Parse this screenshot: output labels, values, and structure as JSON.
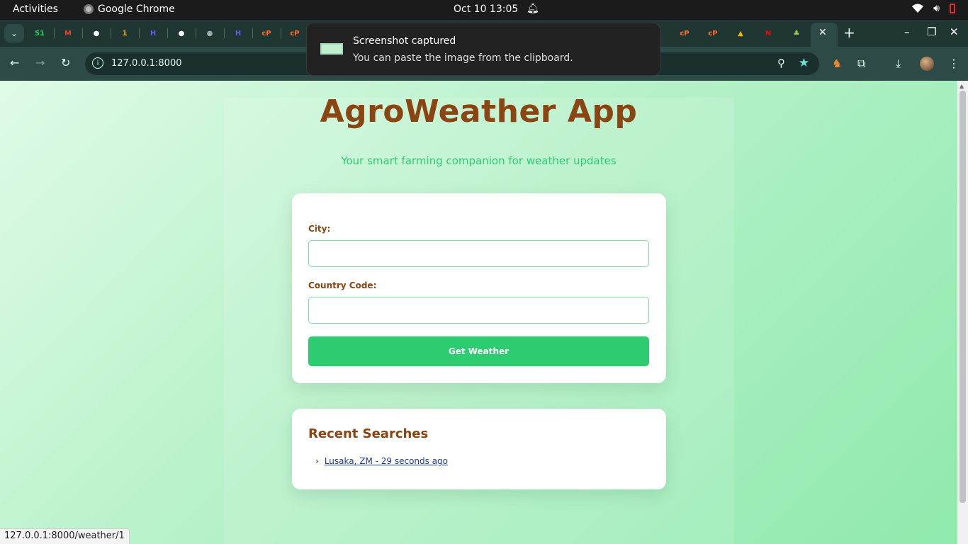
{
  "system_bar": {
    "activities": "Activities",
    "app_name": "Google Chrome",
    "clock": "Oct 10  13:05"
  },
  "browser": {
    "tab_search_icon": "chevron-down-icon",
    "tab_favicons": [
      {
        "name": "whatsapp-tab",
        "glyph": "51",
        "color": "#25d366"
      },
      {
        "name": "gmail-tab",
        "glyph": "M",
        "color": "#ea4335"
      },
      {
        "name": "github-tab",
        "glyph": "",
        "color": "#ffffff"
      },
      {
        "name": "one-tab",
        "glyph": "1",
        "color": "#f4b400"
      },
      {
        "name": "hackathon-tab",
        "glyph": "H",
        "color": "#6c5ce7"
      },
      {
        "name": "github-tab-2",
        "glyph": "",
        "color": "#ffffff"
      },
      {
        "name": "globe-tab",
        "glyph": "",
        "color": "#9aa"
      },
      {
        "name": "hackathon-tab-2",
        "glyph": "H",
        "color": "#6c5ce7"
      },
      {
        "name": "cpanel-tab",
        "glyph": "cP",
        "color": "#ff6c2c"
      },
      {
        "name": "cpanel-tab-2",
        "glyph": "cP",
        "color": "#ff6c2c"
      }
    ],
    "url": "127.0.0.1:8000",
    "new_tab": "+",
    "close_tab": "✕"
  },
  "notification": {
    "title": "Screenshot captured",
    "body": "You can paste the image from the clipboard."
  },
  "app": {
    "title": "AgroWeather App",
    "subtitle": "Your smart farming companion for weather updates",
    "form": {
      "city_label": "City:",
      "city_value": "",
      "country_label": "Country Code:",
      "country_value": "",
      "submit_label": "Get Weather"
    },
    "recent": {
      "title": "Recent Searches",
      "items": [
        {
          "label": "Lusaka, ZM - 29 seconds ago"
        }
      ]
    }
  },
  "status_url": "127.0.0.1:8000/weather/1"
}
